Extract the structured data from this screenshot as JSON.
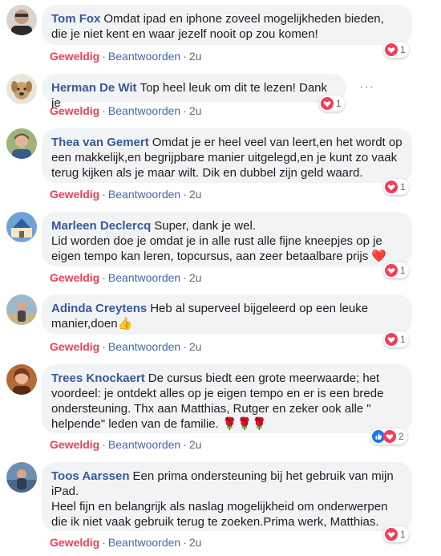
{
  "comments": [
    {
      "author": "Tom Fox",
      "text": "Omdat ipad en iphone zoveel mogelijkheden bieden, die je niet kent en waar jezelf nooit op zou komen!",
      "like_label": "Geweldig",
      "reply_label": "Beantwoorden",
      "time": "2u",
      "reaction_count": "1",
      "reactions": [
        "love"
      ]
    },
    {
      "author": "Herman De Wit",
      "text": "Top heel leuk om dit te lezen! Dank je",
      "like_label": "Geweldig",
      "reply_label": "Beantwoorden",
      "time": "2u",
      "reaction_count": "1",
      "reactions": [
        "love"
      ],
      "more_label": "···"
    },
    {
      "author": "Thea van Gemert",
      "text": "Omdat je er heel veel van leert,en het wordt op een makkelijk,en begrijpbare manier uitgelegd,en je kunt zo vaak terug kijken als je maar wilt. Dik en dubbel zijn geld waard.",
      "like_label": "Geweldig",
      "reply_label": "Beantwoorden",
      "time": "2u",
      "reaction_count": "1",
      "reactions": [
        "love"
      ]
    },
    {
      "author": "Marleen Declercq",
      "text": "Super, dank je wel.\nLid worden doe je omdat je in alle rust alle fijne kneepjes op je eigen tempo kan leren, topcursus, aan zeer betaalbare prijs ❤️",
      "like_label": "Geweldig",
      "reply_label": "Beantwoorden",
      "time": "2u",
      "reaction_count": "1",
      "reactions": [
        "love"
      ]
    },
    {
      "author": "Adinda Creytens",
      "text": "Heb al superveel bijgeleerd op een leuke manier,doen👍",
      "like_label": "Geweldig",
      "reply_label": "Beantwoorden",
      "time": "2u",
      "reaction_count": "1",
      "reactions": [
        "love"
      ]
    },
    {
      "author": "Trees Knockaert",
      "text": "De cursus biedt een grote meerwaarde; het voordeel: je ontdekt alles op je eigen tempo en er is een brede ondersteuning. Thx aan Matthias, Rutger en zeker ook alle \" helpende\" leden van de familie. 🌹🌹🌹",
      "like_label": "Geweldig",
      "reply_label": "Beantwoorden",
      "time": "2u",
      "reaction_count": "2",
      "reactions": [
        "like",
        "love"
      ]
    },
    {
      "author": "Toos Aarssen",
      "text": "Een prima ondersteuning bij het gebruik van mijn iPad.\nHeel fijn en belangrijk als naslag mogelijkheid om onderwerpen die ik niet vaak gebruik terug te zoeken.Prima werk, Matthias.",
      "like_label": "Geweldig",
      "reply_label": "Beantwoorden",
      "time": "2u",
      "reaction_count": "1",
      "reactions": [
        "love"
      ]
    }
  ],
  "separator": "·",
  "colors": {
    "author": "#385898",
    "like_active": "#f33e58",
    "reply": "#4267b2",
    "bubble_bg": "#f2f3f5",
    "meta": "#606770"
  },
  "icons": {
    "love": "heart-reaction-icon",
    "like": "thumbs-up-reaction-icon"
  }
}
